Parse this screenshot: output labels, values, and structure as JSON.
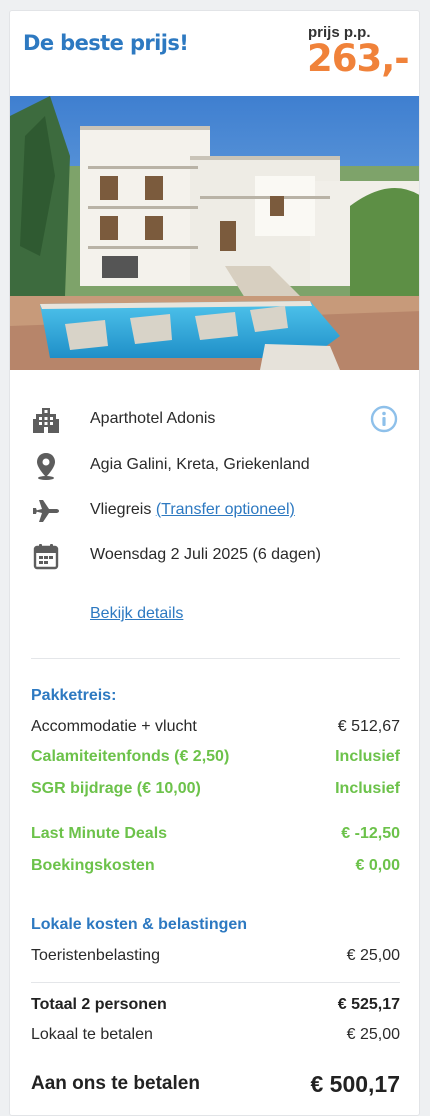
{
  "header": {
    "headline": "De beste prijs!",
    "price_label": "prijs p.p.",
    "price": "263,-",
    "headline_color": "#2d79c1",
    "price_color": "#f0823a"
  },
  "hotel": {
    "name": "Aparthotel Adonis",
    "location": "Agia Galini, Kreta, Griekenland",
    "travel_type": "Vliegreis",
    "transfer_link": "(Transfer optioneel)",
    "date": "Woensdag 2 Juli 2025 (6 dagen)",
    "details_link": "Bekijk details"
  },
  "icons": {
    "hotel": "building-icon",
    "location": "map-pin-icon",
    "travel": "airplane-icon",
    "date": "calendar-icon",
    "info": "info-icon"
  },
  "pricing": {
    "package_title": "Pakketreis:",
    "accommodation": {
      "label": "Accommodatie + vlucht",
      "value": "€ 512,67"
    },
    "calamity_fund": {
      "label": "Calamiteitenfonds (€ 2,50)",
      "value": "Inclusief"
    },
    "sgr": {
      "label": "SGR bijdrage (€ 10,00)",
      "value": "Inclusief"
    },
    "last_minute": {
      "label": "Last Minute Deals",
      "value": "€ -12,50"
    },
    "booking_costs": {
      "label": "Boekingskosten",
      "value": "€ 0,00"
    },
    "local_title": "Lokale kosten & belastingen",
    "tourist_tax": {
      "label": "Toeristenbelasting",
      "value": "€ 25,00"
    },
    "total": {
      "label": "Totaal 2 personen",
      "value": "€ 525,17"
    },
    "local_pay": {
      "label": "Lokaal te betalen",
      "value": "€ 25,00"
    },
    "to_pay": {
      "label": "Aan ons te betalen",
      "value": "€ 500,17"
    },
    "green_color": "#6cc24a"
  }
}
